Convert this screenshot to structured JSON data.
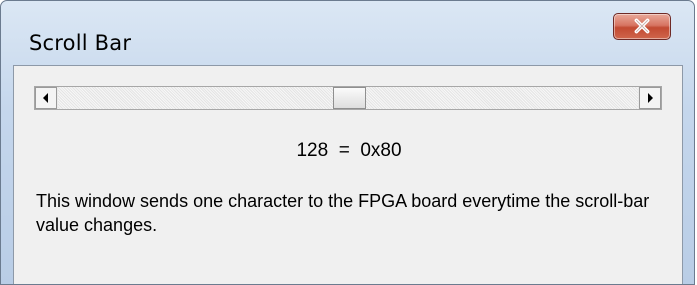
{
  "window": {
    "title": "Scroll Bar"
  },
  "close_button": {
    "icon": "close-icon",
    "color": "#c7503a"
  },
  "scrollbar": {
    "value": 128,
    "min": 0,
    "max": 255,
    "left_arrow_icon": "left-arrow-icon",
    "right_arrow_icon": "right-arrow-icon"
  },
  "readout": {
    "text": "128  =  0x80"
  },
  "description": {
    "text": "This window sends one character to the FPGA board everytime the scroll-bar value changes."
  }
}
